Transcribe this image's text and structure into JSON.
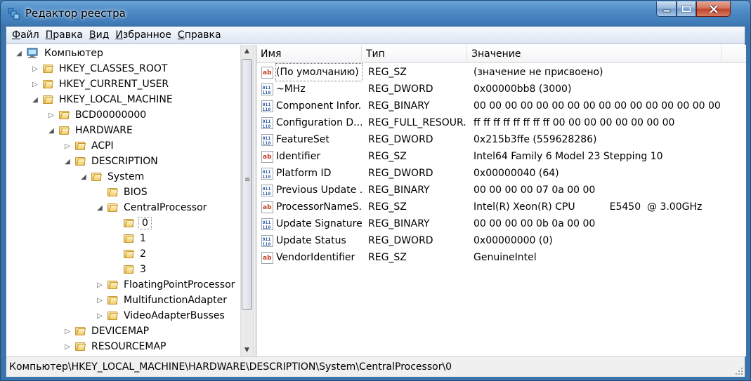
{
  "window": {
    "title": "Редактор реестра"
  },
  "menu": [
    {
      "label": "Файл"
    },
    {
      "label": "Правка"
    },
    {
      "label": "Вид"
    },
    {
      "label": "Избранное"
    },
    {
      "label": "Справка"
    }
  ],
  "tree": {
    "root": "Компьютер",
    "nodes": [
      {
        "label": "HKEY_CLASSES_ROOT",
        "expander": "closed"
      },
      {
        "label": "HKEY_CURRENT_USER",
        "expander": "closed"
      },
      {
        "label": "HKEY_LOCAL_MACHINE",
        "expander": "open"
      },
      {
        "label": "BCD00000000",
        "expander": "closed"
      },
      {
        "label": "HARDWARE",
        "expander": "open"
      },
      {
        "label": "ACPI",
        "expander": "closed"
      },
      {
        "label": "DESCRIPTION",
        "expander": "open"
      },
      {
        "label": "System",
        "expander": "open"
      },
      {
        "label": "BIOS",
        "expander": "none"
      },
      {
        "label": "CentralProcessor",
        "expander": "open"
      },
      {
        "label": "0",
        "expander": "none",
        "selected": true
      },
      {
        "label": "1",
        "expander": "none"
      },
      {
        "label": "2",
        "expander": "none"
      },
      {
        "label": "3",
        "expander": "none"
      },
      {
        "label": "FloatingPointProcessor",
        "expander": "closed"
      },
      {
        "label": "MultifunctionAdapter",
        "expander": "closed"
      },
      {
        "label": "VideoAdapterBusses",
        "expander": "closed"
      },
      {
        "label": "DEVICEMAP",
        "expander": "closed"
      },
      {
        "label": "RESOURCEMAP",
        "expander": "closed"
      }
    ]
  },
  "list": {
    "columns": {
      "name": "Имя",
      "type": "Тип",
      "value": "Значение"
    },
    "rows": [
      {
        "icon": "string-value-icon",
        "name": "(По умолчанию)",
        "type": "REG_SZ",
        "value": "(значение не присвоено)"
      },
      {
        "icon": "binary-value-icon",
        "name": "~MHz",
        "type": "REG_DWORD",
        "value": "0x00000bb8 (3000)"
      },
      {
        "icon": "binary-value-icon",
        "name": "Component Infor...",
        "type": "REG_BINARY",
        "value": "00 00 00 00 00 00 00 00 00 00 00 00 00 00 00 00"
      },
      {
        "icon": "binary-value-icon",
        "name": "Configuration D...",
        "type": "REG_FULL_RESOUR...",
        "value": "ff ff ff ff ff ff ff ff 00 00 00 00 00 00 00 00"
      },
      {
        "icon": "binary-value-icon",
        "name": "FeatureSet",
        "type": "REG_DWORD",
        "value": "0x215b3ffe (559628286)"
      },
      {
        "icon": "string-value-icon",
        "name": "Identifier",
        "type": "REG_SZ",
        "value": "Intel64 Family 6 Model 23 Stepping 10"
      },
      {
        "icon": "binary-value-icon",
        "name": "Platform ID",
        "type": "REG_DWORD",
        "value": "0x00000040 (64)"
      },
      {
        "icon": "binary-value-icon",
        "name": "Previous Update ...",
        "type": "REG_BINARY",
        "value": "00 00 00 00 07 0a 00 00"
      },
      {
        "icon": "string-value-icon",
        "name": "ProcessorNameS...",
        "type": "REG_SZ",
        "value": "Intel(R) Xeon(R) CPU           E5450  @ 3.00GHz"
      },
      {
        "icon": "binary-value-icon",
        "name": "Update Signature",
        "type": "REG_BINARY",
        "value": "00 00 00 00 0b 0a 00 00"
      },
      {
        "icon": "binary-value-icon",
        "name": "Update Status",
        "type": "REG_DWORD",
        "value": "0x00000000 (0)"
      },
      {
        "icon": "string-value-icon",
        "name": "VendorIdentifier",
        "type": "REG_SZ",
        "value": "GenuineIntel"
      }
    ]
  },
  "status": {
    "path": "Компьютер\\HKEY_LOCAL_MACHINE\\HARDWARE\\DESCRIPTION\\System\\CentralProcessor\\0"
  },
  "colors": {
    "title_bar": "#4f8cc6",
    "close_button": "#c0412a",
    "string_icon": "#c23b22",
    "binary_icon": "#2a5aa8"
  }
}
